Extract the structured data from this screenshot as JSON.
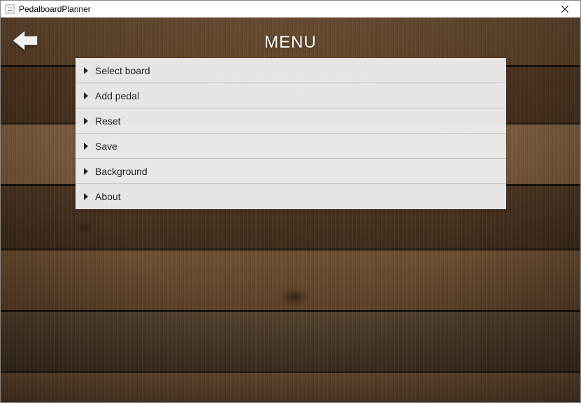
{
  "window": {
    "title": "PedalboardPlanner"
  },
  "header": {
    "title": "MENU"
  },
  "menu": {
    "items": [
      {
        "label": "Select board"
      },
      {
        "label": "Add pedal"
      },
      {
        "label": "Reset"
      },
      {
        "label": "Save"
      },
      {
        "label": "Background"
      },
      {
        "label": "About"
      }
    ]
  }
}
